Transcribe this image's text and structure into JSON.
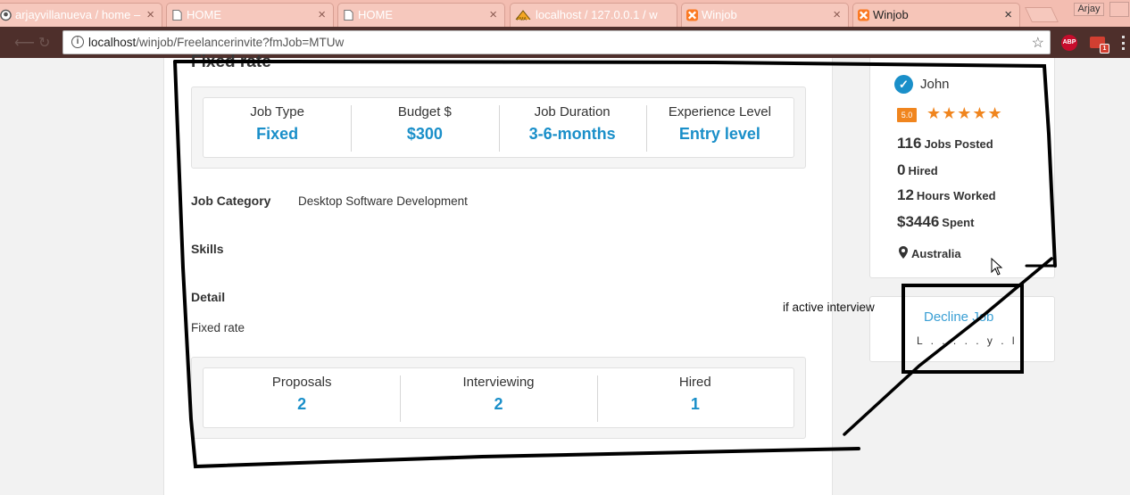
{
  "browser": {
    "tabs": [
      {
        "title": "arjayvillanueva / home –",
        "icon": "github-icon",
        "active": false
      },
      {
        "title": "HOME",
        "icon": "page-icon",
        "active": false
      },
      {
        "title": "HOME",
        "icon": "page-icon",
        "active": false
      },
      {
        "title": "localhost / 127.0.0.1 / w",
        "icon": "phpmyadmin-icon",
        "active": false
      },
      {
        "title": "Winjob",
        "icon": "xampp-icon",
        "active": false
      },
      {
        "title": "Winjob",
        "icon": "xampp-icon",
        "active": true
      }
    ],
    "user": "Arjay",
    "url_host": "localhost",
    "url_path": "/winjob/Freelancerinvite?fmJob=MTUw",
    "extensions": {
      "abp_label": "ABP",
      "mail_badge": "1"
    }
  },
  "job": {
    "section_title": "Fixed rate",
    "stats": [
      {
        "label": "Job Type",
        "value": "Fixed"
      },
      {
        "label": "Budget $",
        "value": "$300"
      },
      {
        "label": "Job Duration",
        "value": "3-6-months"
      },
      {
        "label": "Experience Level",
        "value": "Entry level"
      }
    ],
    "category_label": "Job Category",
    "category_value": "Desktop Software Development",
    "skills_label": "Skills",
    "detail_label": "Detail",
    "detail_value": "Fixed rate",
    "proposals": [
      {
        "label": "Proposals",
        "value": "2"
      },
      {
        "label": "Interviewing",
        "value": "2"
      },
      {
        "label": "Hired",
        "value": "1"
      }
    ]
  },
  "client": {
    "name": "John",
    "rating": "5.0",
    "stars": 5,
    "jobs_posted_num": "116",
    "jobs_posted_label": "Jobs Posted",
    "hired_num": "0",
    "hired_label": "Hired",
    "hours_num": "12",
    "hours_label": "Hours Worked",
    "spent_num": "$3446",
    "spent_label": "Spent",
    "location": "Australia"
  },
  "actions": {
    "decline_label": "Decline Job",
    "decline_sub": "L . . . . . y . l"
  },
  "annotation": {
    "note": "if active interview"
  },
  "colors": {
    "accent": "#1a8fc9",
    "star": "#f0851e",
    "tabbar": "#f3bdb1",
    "toolbar": "#4e2f2b"
  }
}
